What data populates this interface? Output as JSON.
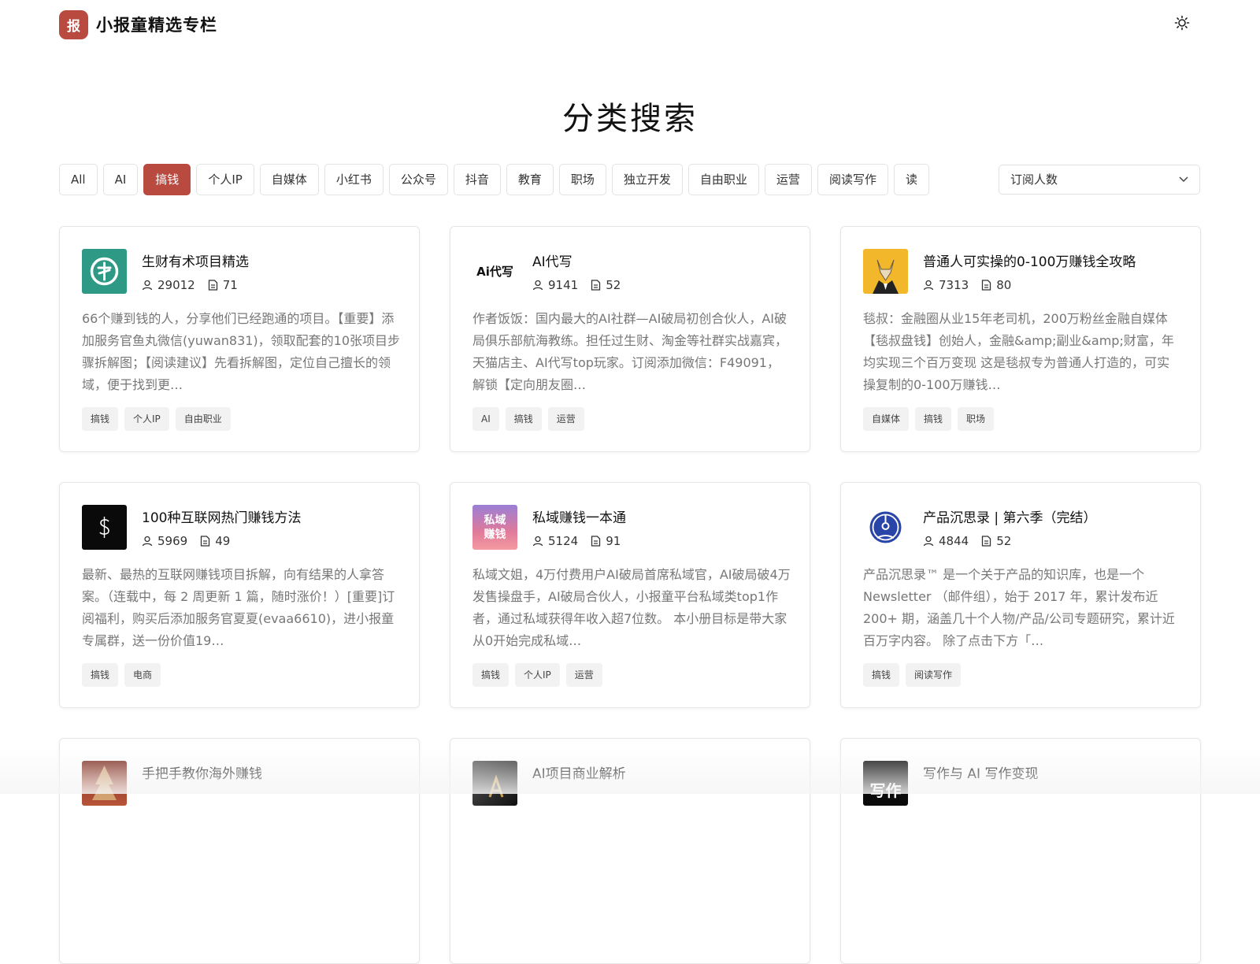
{
  "header": {
    "logo_char": "报",
    "site_title": "小报童精选专栏",
    "theme_toggle_icon": "sun-icon"
  },
  "page": {
    "title": "分类搜索"
  },
  "filters": {
    "chips": [
      "All",
      "AI",
      "搞钱",
      "个人IP",
      "自媒体",
      "小红书",
      "公众号",
      "抖音",
      "教育",
      "职场",
      "独立开发",
      "自由职业",
      "运营",
      "阅读写作",
      "读"
    ],
    "active": "搞钱"
  },
  "sort": {
    "selected": "订阅人数",
    "icon": "chevron-down-icon"
  },
  "colors": {
    "accent": "#b84a40"
  },
  "cards": [
    {
      "title": "生财有术项目精选",
      "subscribers": "29012",
      "articles": "71",
      "desc": "66个赚到钱的人，分享他们已经跑通的项目。【重要】添加服务官鱼丸微信(yuwan831)，领取配套的10张项目步骤拆解图；【阅读建议】先看拆解图，定位自己擅长的领域，便于找到更…",
      "tags": [
        "搞钱",
        "个人IP",
        "自由职业"
      ],
      "thumb": "coin-logo"
    },
    {
      "title": "AI代写",
      "subscribers": "9141",
      "articles": "52",
      "desc": "作者饭饭：国内最大的AI社群—AI破局初创合伙人，AI破局俱乐部航海教练。担任过生财、淘金等社群实战嘉宾，天猫店主、AI代写top玩家。订阅添加微信：F49091，解锁【定向朋友圈…",
      "tags": [
        "AI",
        "搞钱",
        "运营"
      ],
      "thumb_text": "Ai代写"
    },
    {
      "title": "普通人可实操的0-100万赚钱全攻略",
      "subscribers": "7313",
      "articles": "80",
      "desc": "毯叔：金融圈从业15年老司机，200万粉丝金融自媒体【毯叔盘钱】创始人，金融&amp;副业&amp;财富，年均实现三个百万变现 这是毯叔专为普通人打造的，可实操复制的0-100万赚钱…",
      "tags": [
        "自媒体",
        "搞钱",
        "职场"
      ],
      "thumb": "fox-portrait"
    },
    {
      "title": "100种互联网热门赚钱方法",
      "subscribers": "5969",
      "articles": "49",
      "desc": "最新、最热的互联网赚钱项目拆解，向有结果的人拿答案。（连载中，每 2 周更新 1 篇，随时涨价！）[重要]订阅福利，购买后添加服务官夏夏(evaa6610)，进小报童专属群，送一份价值19…",
      "tags": [
        "搞钱",
        "电商"
      ],
      "thumb": "dollar-logo"
    },
    {
      "title": "私域赚钱一本通",
      "subscribers": "5124",
      "articles": "91",
      "desc": "私域文姐，4万付费用户AI破局首席私域官，AI破局破4万发售操盘手，AI破局合伙人，小报童平台私域类top1作者，通过私域获得年收入超7位数。 本小册目标是带大家从0开始完成私域…",
      "tags": [
        "搞钱",
        "个人IP",
        "运营"
      ],
      "thumb_lines": [
        "私域",
        "赚钱"
      ]
    },
    {
      "title": "产品沉思录 | 第六季（完结）",
      "subscribers": "4844",
      "articles": "52",
      "desc": "产品沉思录™ 是一个关于产品的知识库，也是一个 Newsletter （邮件组），始于 2017 年，累计发布近 200+ 期，涵盖几十个人物/产品/公司专题研究，累计近百万字内容。 除了点击下方「…",
      "tags": [
        "搞钱",
        "阅读写作"
      ],
      "thumb": "compass-logo"
    },
    {
      "title": "手把手教你海外赚钱",
      "subscribers": "",
      "articles": "",
      "desc": "",
      "tags": [],
      "thumb": "tree-photo"
    },
    {
      "title": "AI项目商业解析",
      "subscribers": "",
      "articles": "",
      "desc": "",
      "tags": [],
      "thumb": "ai-letter-photo"
    },
    {
      "title": "写作与 AI 写作变现",
      "subscribers": "",
      "articles": "",
      "desc": "",
      "tags": [],
      "thumb_text": "写作"
    }
  ]
}
